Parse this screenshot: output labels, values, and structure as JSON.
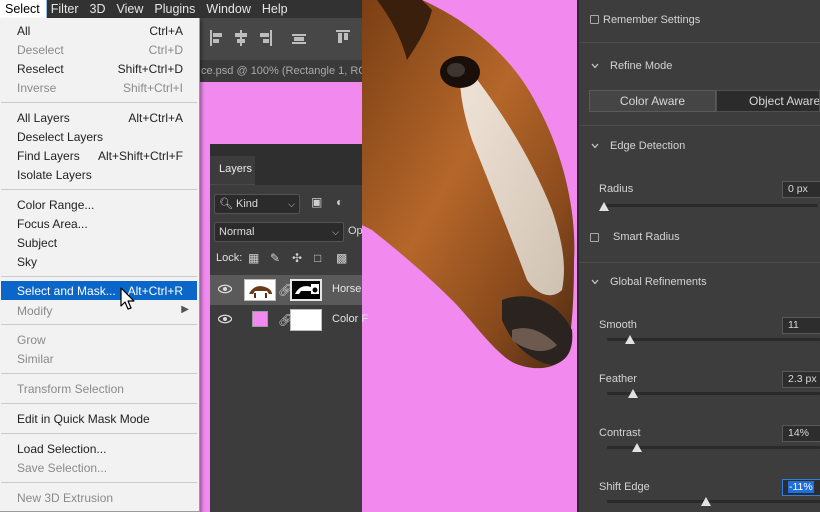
{
  "menubar": {
    "items": [
      "Select",
      "Filter",
      "3D",
      "View",
      "Plugins",
      "Window",
      "Help"
    ],
    "active_index": 0
  },
  "document": {
    "tab_title": "ce.psd @ 100% (Rectangle 1, RG"
  },
  "select_menu": {
    "items": [
      {
        "label": "All",
        "shortcut": "Ctrl+A",
        "enabled": true
      },
      {
        "label": "Deselect",
        "shortcut": "Ctrl+D",
        "enabled": false
      },
      {
        "label": "Reselect",
        "shortcut": "Shift+Ctrl+D",
        "enabled": true
      },
      {
        "label": "Inverse",
        "shortcut": "Shift+Ctrl+I",
        "enabled": false
      },
      {
        "label": "All Layers",
        "shortcut": "Alt+Ctrl+A",
        "enabled": true
      },
      {
        "label": "Deselect Layers",
        "shortcut": "",
        "enabled": true
      },
      {
        "label": "Find Layers",
        "shortcut": "Alt+Shift+Ctrl+F",
        "enabled": true
      },
      {
        "label": "Isolate Layers",
        "shortcut": "",
        "enabled": true
      },
      {
        "label": "Color Range...",
        "shortcut": "",
        "enabled": true
      },
      {
        "label": "Focus Area...",
        "shortcut": "",
        "enabled": true
      },
      {
        "label": "Subject",
        "shortcut": "",
        "enabled": true
      },
      {
        "label": "Sky",
        "shortcut": "",
        "enabled": true
      },
      {
        "label": "Select and Mask...",
        "shortcut": "Alt+Ctrl+R",
        "enabled": true,
        "highlighted": true
      },
      {
        "label": "Modify",
        "shortcut": "",
        "enabled": false,
        "submenu": true
      },
      {
        "label": "Grow",
        "shortcut": "",
        "enabled": false
      },
      {
        "label": "Similar",
        "shortcut": "",
        "enabled": false
      },
      {
        "label": "Transform Selection",
        "shortcut": "",
        "enabled": false
      },
      {
        "label": "Edit in Quick Mask Mode",
        "shortcut": "",
        "enabled": true
      },
      {
        "label": "Load Selection...",
        "shortcut": "",
        "enabled": true
      },
      {
        "label": "Save Selection...",
        "shortcut": "",
        "enabled": false
      },
      {
        "label": "New 3D Extrusion",
        "shortcut": "",
        "enabled": false
      }
    ]
  },
  "layers_panel": {
    "tab_label": "Layers",
    "filter_kind": "Kind",
    "blend_mode": "Normal",
    "opacity_label": "Op",
    "lock_label": "Lock:",
    "layers": [
      {
        "name": "Horse",
        "selected": true
      },
      {
        "name": "Color F",
        "selected": false
      }
    ],
    "color_fill_swatch": "#f289ef"
  },
  "properties": {
    "remember_settings": "Remember Settings",
    "refine_mode": {
      "title": "Refine Mode",
      "options": [
        "Color Aware",
        "Object Aware"
      ]
    },
    "edge_detection": {
      "title": "Edge Detection",
      "radius_label": "Radius",
      "radius_value": "0 px",
      "smart_radius": "Smart Radius"
    },
    "global_refinements": {
      "title": "Global Refinements",
      "smooth": {
        "label": "Smooth",
        "value": "11"
      },
      "feather": {
        "label": "Feather",
        "value": "2.3 px"
      },
      "contrast": {
        "label": "Contrast",
        "value": "14%"
      },
      "shift_edge": {
        "label": "Shift Edge",
        "value": "-11%"
      }
    }
  },
  "colors": {
    "canvas_bg": "#f289ef",
    "menu_highlight": "#0a67c9",
    "panel_bg": "#3d3d3d"
  }
}
